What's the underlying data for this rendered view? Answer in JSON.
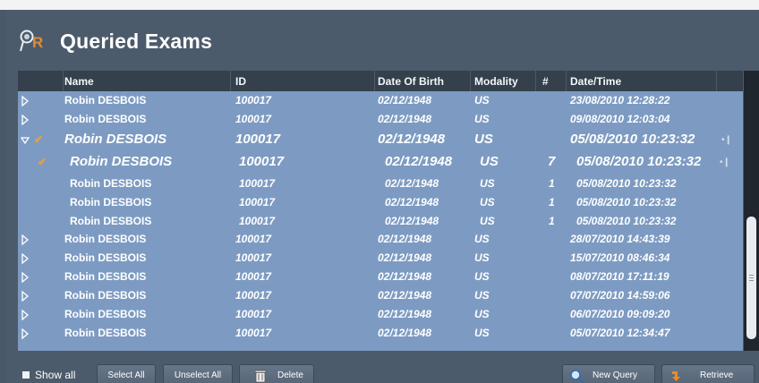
{
  "header": {
    "title": "Queried Exams",
    "logo": "QR"
  },
  "columns": {
    "name": "Name",
    "id": "ID",
    "dob": "Date Of Birth",
    "modality": "Modality",
    "count": "#",
    "datetime": "Date/Time"
  },
  "rows": [
    {
      "kind": "collapsed",
      "name": "Robin DESBOIS",
      "id": "100017",
      "dob": "02/12/1948",
      "modality": "US",
      "count": "",
      "datetime": "23/08/2010 12:28:22"
    },
    {
      "kind": "collapsed",
      "name": "Robin DESBOIS",
      "id": "100017",
      "dob": "02/12/1948",
      "modality": "US",
      "count": "",
      "datetime": "09/08/2010 12:03:04"
    },
    {
      "kind": "expanded",
      "name": "Robin DESBOIS",
      "id": "100017",
      "dob": "02/12/1948",
      "modality": "US",
      "count": "",
      "datetime": "05/08/2010 10:23:32"
    },
    {
      "kind": "series-selected",
      "name": "Robin DESBOIS",
      "id": "100017",
      "dob": "02/12/1948",
      "modality": "US",
      "count": "7",
      "datetime": "05/08/2010 10:23:32"
    },
    {
      "kind": "series",
      "name": "Robin DESBOIS",
      "id": "100017",
      "dob": "02/12/1948",
      "modality": "US",
      "count": "1",
      "datetime": "05/08/2010 10:23:32"
    },
    {
      "kind": "series",
      "name": "Robin DESBOIS",
      "id": "100017",
      "dob": "02/12/1948",
      "modality": "US",
      "count": "1",
      "datetime": "05/08/2010 10:23:32"
    },
    {
      "kind": "series",
      "name": "Robin DESBOIS",
      "id": "100017",
      "dob": "02/12/1948",
      "modality": "US",
      "count": "1",
      "datetime": "05/08/2010 10:23:32"
    },
    {
      "kind": "collapsed",
      "name": "Robin DESBOIS",
      "id": "100017",
      "dob": "02/12/1948",
      "modality": "US",
      "count": "",
      "datetime": "28/07/2010 14:43:39"
    },
    {
      "kind": "collapsed",
      "name": "Robin DESBOIS",
      "id": "100017",
      "dob": "02/12/1948",
      "modality": "US",
      "count": "",
      "datetime": "15/07/2010 08:46:34"
    },
    {
      "kind": "collapsed",
      "name": "Robin DESBOIS",
      "id": "100017",
      "dob": "02/12/1948",
      "modality": "US",
      "count": "",
      "datetime": "08/07/2010 17:11:19"
    },
    {
      "kind": "collapsed",
      "name": "Robin DESBOIS",
      "id": "100017",
      "dob": "02/12/1948",
      "modality": "US",
      "count": "",
      "datetime": "07/07/2010 14:59:06"
    },
    {
      "kind": "collapsed",
      "name": "Robin DESBOIS",
      "id": "100017",
      "dob": "02/12/1948",
      "modality": "US",
      "count": "",
      "datetime": "06/07/2010 09:09:20"
    },
    {
      "kind": "collapsed",
      "name": "Robin DESBOIS",
      "id": "100017",
      "dob": "02/12/1948",
      "modality": "US",
      "count": "",
      "datetime": "05/07/2010 12:34:47"
    }
  ],
  "footer": {
    "show_all": "Show all",
    "select_all": "Select All",
    "unselect_all": "Unselect All",
    "delete": "Delete",
    "new_query": "New Query",
    "retrieve": "Retrieve"
  },
  "icons": {
    "expander_collapsed": "triangle-right-icon",
    "expander_expanded": "triangle-down-icon",
    "check": "checkmark-icon",
    "context": "context-menu-icon",
    "delete": "trash-icon",
    "new_query": "magnifier-icon",
    "retrieve": "download-arrow-icon"
  },
  "colors": {
    "background": "#4c5b6b",
    "table": "#7d9bc2",
    "header_row": "#34404c",
    "check": "#f0a030"
  }
}
